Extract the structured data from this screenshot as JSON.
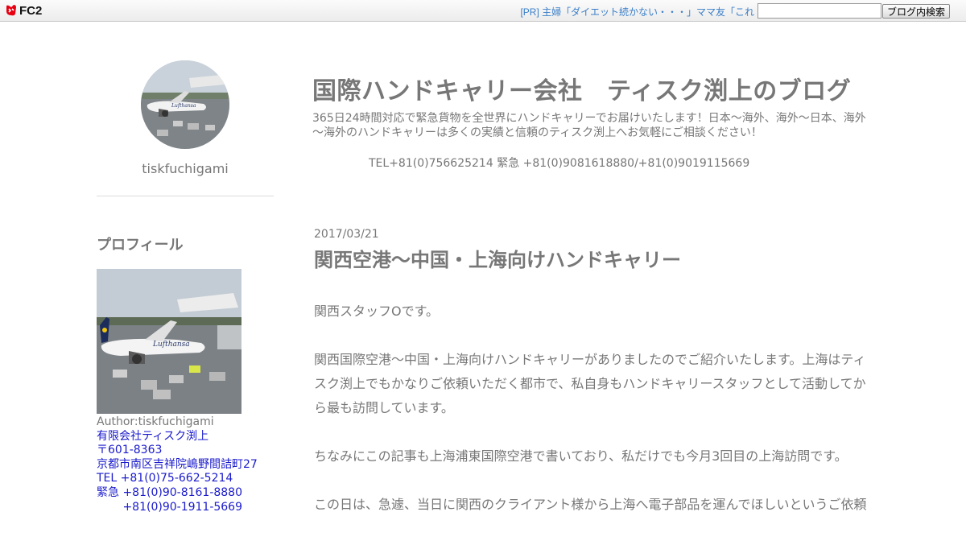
{
  "fc2bar": {
    "logo_text": "FC2",
    "pr_link": "[PR] 主婦「ダイエット続かない・・・」ママ友「これ",
    "search_placeholder": "",
    "search_button": "ブログ内検索"
  },
  "sidebar": {
    "author_name": "tiskfuchigami",
    "profile_heading": "プロフィール",
    "author_line": "Author:tiskfuchigami",
    "profile_links": [
      "有限会社ティスク渕上",
      "〒601-8363",
      "京都市南区吉祥院嶋野間詰町27",
      "TEL +81(0)75-662-5214",
      "緊急 +81(0)90-8161-8880",
      "　　 +81(0)90-1911-5669"
    ]
  },
  "header": {
    "title": "国際ハンドキャリー会社　ティスク渕上のブログ",
    "description": "365日24時間対応で緊急貨物を全世界にハンドキャリーでお届けいたします！日本～海外、海外～日本、海外～海外のハンドキャリーは多くの実績と信頼のティスク渕上へお気軽にご相談ください！",
    "tel": "TEL+81(0)756625214 緊急 +81(0)9081618880/+81(0)9019115669"
  },
  "entry": {
    "date": "2017/03/21",
    "title": "関西空港～中国・上海向けハンドキャリー",
    "paragraphs": [
      "関西スタッフOです。",
      "関西国際空港～中国・上海向けハンドキャリーがありましたのでご紹介いたします。上海はティスク渕上でもかなりご依頼いただく都市で、私自身もハンドキャリースタッフとして活動してから最も訪問しています。",
      "ちなみにこの記事も上海浦東国際空港で書いており、私だけでも今月3回目の上海訪問です。",
      "この日は、急遽、当日に関西のクライアント様から上海へ電子部品を運んでほしいというご依頼"
    ]
  },
  "colors": {
    "text": "#777777",
    "link_blue": "#1a1acc",
    "pr_blue": "#3a7fc9",
    "fc2_red": "#e60012"
  },
  "icons": {
    "logo": "fc2-logo-icon",
    "avatar": "airport-lufthansa-photo",
    "profile": "airport-lufthansa-photo"
  }
}
